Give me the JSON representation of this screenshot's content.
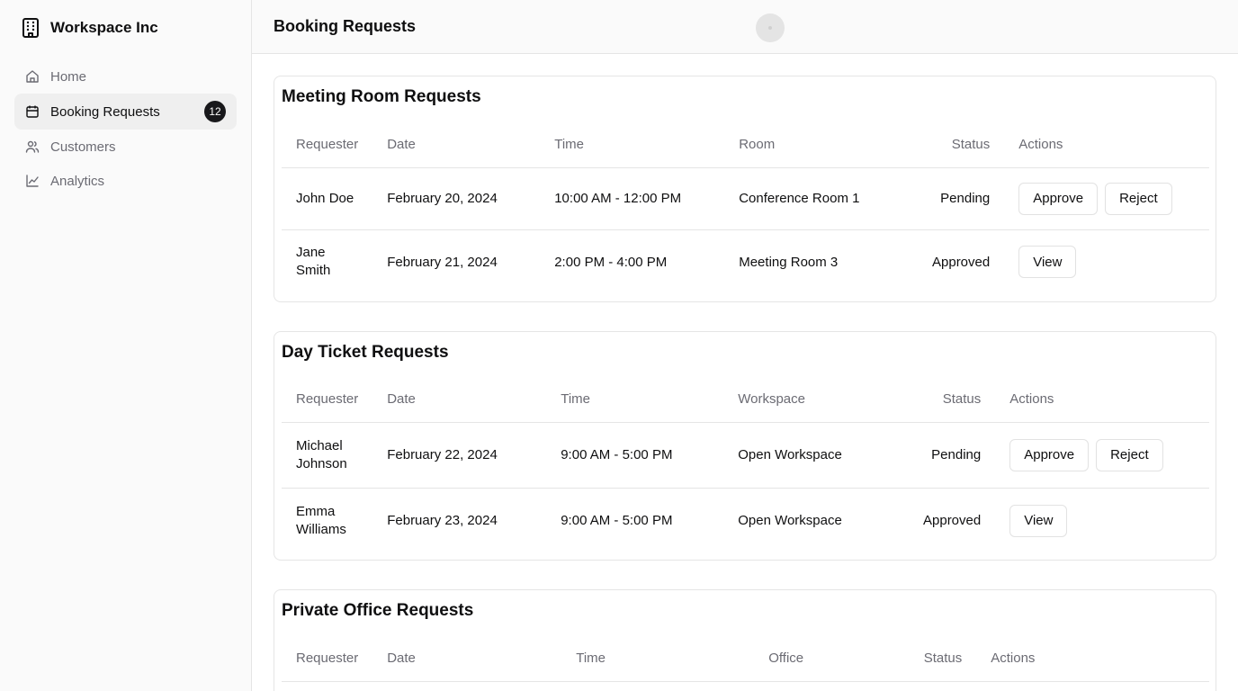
{
  "brand": {
    "name": "Workspace Inc",
    "icon": "building-icon"
  },
  "nav": {
    "home": "Home",
    "booking": "Booking Requests",
    "booking_badge": "12",
    "customers": "Customers",
    "analytics": "Analytics"
  },
  "header": {
    "title": "Booking Requests"
  },
  "meeting": {
    "title": "Meeting Room Requests",
    "columns": {
      "requester": "Requester",
      "date": "Date",
      "time": "Time",
      "place": "Room",
      "status": "Status",
      "actions": "Actions"
    },
    "rows": [
      {
        "requester": "John Doe",
        "date": "February 20, 2024",
        "time": "10:00 AM - 12:00 PM",
        "place": "Conference Room 1",
        "status": "Pending",
        "action1": "Approve",
        "action2": "Reject"
      },
      {
        "requester": "Jane Smith",
        "date": "February 21, 2024",
        "time": "2:00 PM - 4:00 PM",
        "place": "Meeting Room 3",
        "status": "Approved",
        "action1": "View"
      }
    ]
  },
  "day": {
    "title": "Day Ticket Requests",
    "columns": {
      "requester": "Requester",
      "date": "Date",
      "time": "Time",
      "place": "Workspace",
      "status": "Status",
      "actions": "Actions"
    },
    "rows": [
      {
        "requester": "Michael Johnson",
        "date": "February 22, 2024",
        "time": "9:00 AM - 5:00 PM",
        "place": "Open Workspace",
        "status": "Pending",
        "action1": "Approve",
        "action2": "Reject"
      },
      {
        "requester": "Emma Williams",
        "date": "February 23, 2024",
        "time": "9:00 AM - 5:00 PM",
        "place": "Open Workspace",
        "status": "Approved",
        "action1": "View"
      }
    ]
  },
  "office": {
    "title": "Private Office Requests",
    "columns": {
      "requester": "Requester",
      "date": "Date",
      "time": "Time",
      "place": "Office",
      "status": "Status",
      "actions": "Actions"
    }
  },
  "colors": {
    "badge_bg": "#18181b",
    "sidebar_bg": "#fafafa",
    "active_bg": "#efefef",
    "muted_text": "#6b6b73"
  }
}
